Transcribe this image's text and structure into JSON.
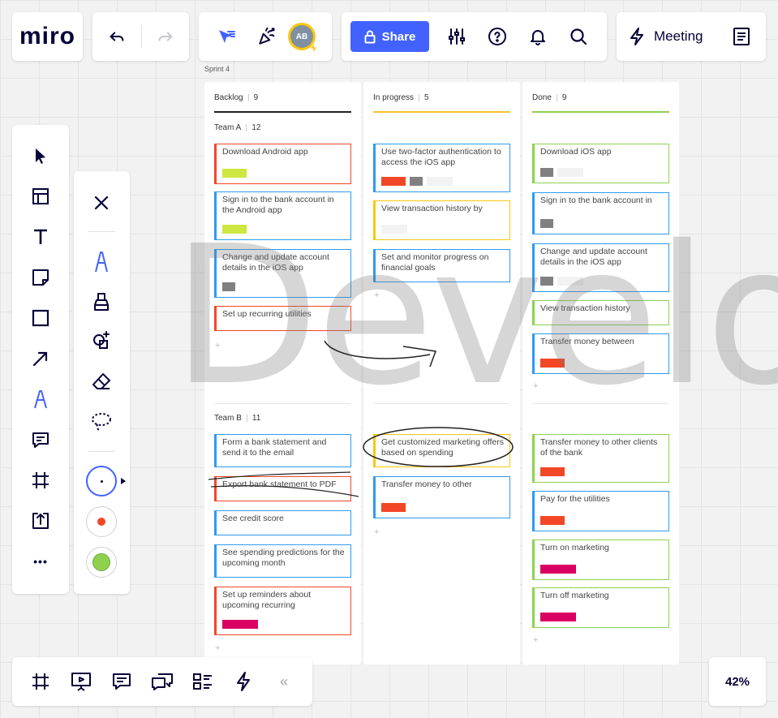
{
  "app": {
    "logo": "miro"
  },
  "toolbar": {
    "share_label": "Share",
    "meeting_label": "Meeting",
    "avatar_initials": "AB"
  },
  "board": {
    "frame_label": "Sprint 4",
    "watermark": "Develop",
    "zoom": "42%"
  },
  "columns": [
    {
      "title": "Backlog",
      "count": "9",
      "color": "#222222"
    },
    {
      "title": "In progress",
      "count": "5",
      "color": "#f5c12e"
    },
    {
      "title": "Done",
      "count": "9",
      "color": "#8fd14f"
    }
  ],
  "teams": [
    {
      "name": "Team A",
      "count": "12"
    },
    {
      "name": "Team B",
      "count": "11"
    }
  ],
  "cards": {
    "backlog_a": [
      {
        "text": "Download Android app",
        "color": "#f24726",
        "tags": [
          "#cee741"
        ]
      },
      {
        "text": "Sign in to the bank account in the Android app",
        "color": "#2d9bf0",
        "tags": [
          "#cee741"
        ]
      },
      {
        "text": "Change and update account details in the iOS app",
        "color": "#2d9bf0",
        "tags": [
          "#808080"
        ]
      },
      {
        "text": "Set up recurring utilities",
        "color": "#f24726",
        "tags": []
      }
    ],
    "progress_a": [
      {
        "text": "Use two-factor authentication to access the iOS app",
        "color": "#2d9bf0",
        "tags": [
          "#f24726",
          "#808080",
          "#f2f2f2"
        ]
      },
      {
        "text": "View transaction history by",
        "color": "#fac710",
        "tags": [
          "#f2f2f2"
        ]
      },
      {
        "text": "Set and monitor progress on financial goals",
        "color": "#2d9bf0",
        "tags": []
      }
    ],
    "done_a": [
      {
        "text": "Download iOS app",
        "color": "#8fd14f",
        "tags": [
          "#808080",
          "#f2f2f2"
        ]
      },
      {
        "text": "Sign in to the bank account in",
        "color": "#2d9bf0",
        "tags": [
          "#808080"
        ]
      },
      {
        "text": "Change and update account details in the iOS app",
        "color": "#2d9bf0",
        "tags": [
          "#808080",
          "#f2f2f2"
        ]
      },
      {
        "text": "View transaction history",
        "color": "#8fd14f",
        "tags": []
      },
      {
        "text": "Transfer money between",
        "color": "#2d9bf0",
        "tags": [
          "#f24726"
        ]
      }
    ],
    "backlog_b": [
      {
        "text": "Form a bank statement and send it to the email",
        "color": "#2d9bf0",
        "tags": []
      },
      {
        "text": "Export bank statement to PDF",
        "color": "#f24726",
        "tags": []
      },
      {
        "text": "See credit score",
        "color": "#2d9bf0",
        "tags": []
      },
      {
        "text": "See spending predictions for the upcoming month",
        "color": "#2d9bf0",
        "tags": []
      },
      {
        "text": "Set up reminders about upcoming recurring",
        "color": "#f24726",
        "tags": [
          "#da0063"
        ]
      }
    ],
    "progress_b": [
      {
        "text": "Get customized marketing offers based on spending",
        "color": "#fac710",
        "tags": []
      },
      {
        "text": "Transfer money to other",
        "color": "#2d9bf0",
        "tags": [
          "#f24726"
        ]
      }
    ],
    "done_b": [
      {
        "text": "Transfer money to other clients of the bank",
        "color": "#8fd14f",
        "tags": [
          "#f24726"
        ]
      },
      {
        "text": "Pay for the utilities",
        "color": "#2d9bf0",
        "tags": [
          "#f24726"
        ]
      },
      {
        "text": "Turn on marketing",
        "color": "#8fd14f",
        "tags": [
          "#da0063"
        ]
      },
      {
        "text": "Turn off marketing",
        "color": "#8fd14f",
        "tags": [
          "#da0063"
        ]
      }
    ]
  },
  "add_symbol": "+",
  "more_symbol": "•••",
  "collapse_symbol": "«"
}
